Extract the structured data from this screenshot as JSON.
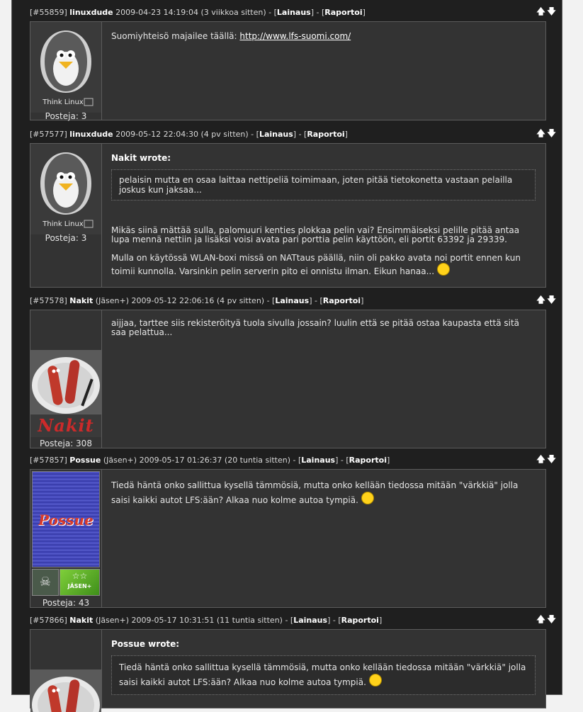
{
  "nav": {
    "up": "🡅",
    "down": "🡇"
  },
  "posts": [
    {
      "id": "[#55859]",
      "author": "linuxdude",
      "meta": "2009-04-23 14:19:04 (3 viikkoa sitten) - [",
      "quote_link": "Lainaus",
      "sep": "] - [",
      "report_link": "Raportoi",
      "end": "]",
      "avatar_caption": "Think Linux",
      "posts_count": "Posteja: 3",
      "text_prefix": "Suomiyhteisö majailee täällä: ",
      "link": "http://www.lfs-suomi.com/"
    },
    {
      "id": "[#57577]",
      "author": "linuxdude",
      "meta": "2009-05-12 22:04:30 (4 pv sitten) - [",
      "quote_link": "Lainaus",
      "sep": "] - [",
      "report_link": "Raportoi",
      "end": "]",
      "avatar_caption": "Think Linux",
      "posts_count": "Posteja: 3",
      "quote_author": "Nakit wrote:",
      "quote_text": "pelaisin mutta en osaa laittaa nettipeliä toimimaan, joten pitää tietokonetta vastaan pelailla joskus kun jaksaa...",
      "para1": "Mikäs siinä mättää sulla, palomuuri kenties plokkaa pelin vai? Ensimmäiseksi pelille pitää antaa lupa mennä nettiin ja lisäksi voisi avata pari porttia pelin käyttöön,  eli portit 63392 ja 29339.",
      "para2": "Mulla on käytössä WLAN-boxi missä on NATtaus päällä, niin oli pakko avata noi portit ennen kun toimii kunnolla. Varsinkin pelin serverin pito ei onnistu ilman. Eikun hanaa..."
    },
    {
      "id": "[#57578]",
      "author": "Nakit",
      "rank": "(Jäsen+)",
      "meta": "2009-05-12 22:06:16 (4 pv sitten) - [",
      "quote_link": "Lainaus",
      "sep": "] - [",
      "report_link": "Raportoi",
      "end": "]",
      "nick_logo": "Nakit",
      "posts_count": "Posteja: 308",
      "text": "aijjaa, tarttee siis rekisteröityä tuola sivulla jossain? luulin että se pitää ostaa kaupasta että sitä saa pelattua..."
    },
    {
      "id": "[#57857]",
      "author": "Possue",
      "rank": "(Jäsen+)",
      "meta": "2009-05-17 01:26:37 (20 tuntia sitten) - [",
      "quote_link": "Lainaus",
      "sep": "] - [",
      "report_link": "Raportoi",
      "end": "]",
      "avatar_text": "Possue",
      "badge_text": "JÄSEN+",
      "badge_stars": "☆☆",
      "posts_count": "Posteja: 43",
      "text": "Tiedä häntä onko sallittua kysellä tämmösiä, mutta onko kellään tiedossa mitään \"värkkiä\" jolla saisi kaikki autot LFS:ään? Alkaa nuo kolme autoa tympiä."
    },
    {
      "id": "[#57866]",
      "author": "Nakit",
      "rank": "(Jäsen+)",
      "meta": "2009-05-17 10:31:51 (11 tuntia sitten) - [",
      "quote_link": "Lainaus",
      "sep": "] - [",
      "report_link": "Raportoi",
      "end": "]",
      "quote_author": "Possue wrote:",
      "quote_text": "Tiedä häntä onko sallittua kysellä tämmösiä, mutta onko kellään tiedossa mitään \"värkkiä\" jolla saisi kaikki autot LFS:ään? Alkaa nuo kolme autoa tympiä."
    }
  ]
}
